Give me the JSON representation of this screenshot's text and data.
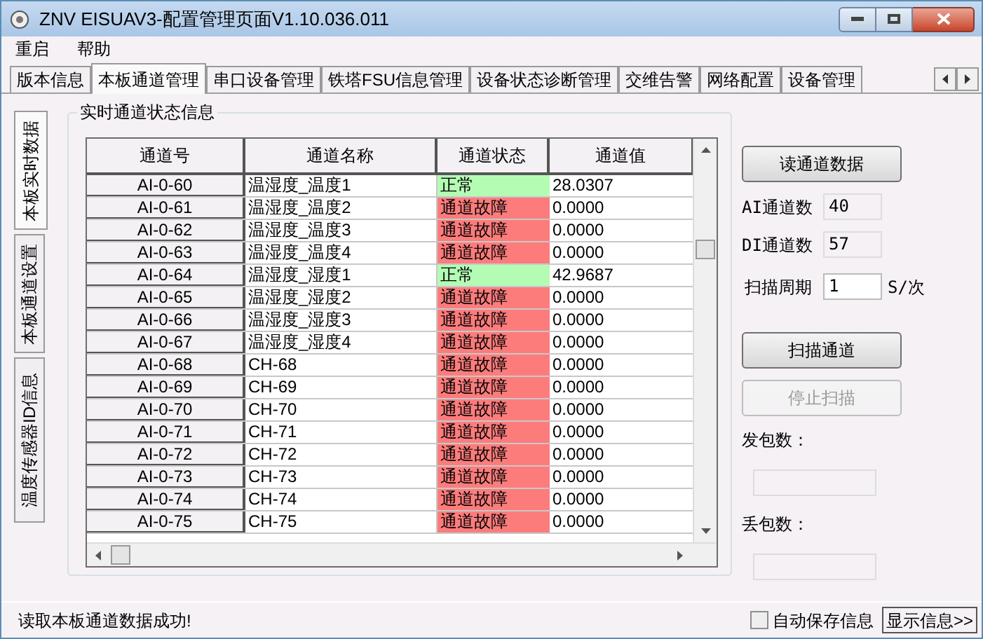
{
  "window": {
    "title": "ZNV EISUAV3-配置管理页面V1.10.036.011"
  },
  "menu": [
    "重启",
    "帮助"
  ],
  "tabs": [
    {
      "label": "版本信息",
      "selected": false
    },
    {
      "label": "本板通道管理",
      "selected": true
    },
    {
      "label": "串口设备管理",
      "selected": false
    },
    {
      "label": "铁塔FSU信息管理",
      "selected": false
    },
    {
      "label": "设备状态诊断管理",
      "selected": false
    },
    {
      "label": "交维告警",
      "selected": false
    },
    {
      "label": "网络配置",
      "selected": false
    },
    {
      "label": "设备管理",
      "selected": false
    }
  ],
  "side_tabs": [
    {
      "label": "本板实时数据",
      "selected": true
    },
    {
      "label": "本板通道设置",
      "selected": false
    },
    {
      "label": "温度传感器ID信息",
      "selected": false
    }
  ],
  "group_title": "实时通道状态信息",
  "table": {
    "columns": [
      "通道号",
      "通道名称",
      "通道状态",
      "通道值"
    ],
    "rows": [
      {
        "id": "AI-0-60",
        "name": "温湿度_温度1",
        "status": "正常",
        "kind": "normal",
        "value": "28.0307"
      },
      {
        "id": "AI-0-61",
        "name": "温湿度_温度2",
        "status": "通道故障",
        "kind": "fault",
        "value": "0.0000"
      },
      {
        "id": "AI-0-62",
        "name": "温湿度_温度3",
        "status": "通道故障",
        "kind": "fault",
        "value": "0.0000"
      },
      {
        "id": "AI-0-63",
        "name": "温湿度_温度4",
        "status": "通道故障",
        "kind": "fault",
        "value": "0.0000"
      },
      {
        "id": "AI-0-64",
        "name": "温湿度_湿度1",
        "status": "正常",
        "kind": "normal",
        "value": "42.9687"
      },
      {
        "id": "AI-0-65",
        "name": "温湿度_湿度2",
        "status": "通道故障",
        "kind": "fault",
        "value": "0.0000"
      },
      {
        "id": "AI-0-66",
        "name": "温湿度_湿度3",
        "status": "通道故障",
        "kind": "fault",
        "value": "0.0000"
      },
      {
        "id": "AI-0-67",
        "name": "温湿度_湿度4",
        "status": "通道故障",
        "kind": "fault",
        "value": "0.0000"
      },
      {
        "id": "AI-0-68",
        "name": "CH-68",
        "status": "通道故障",
        "kind": "fault",
        "value": "0.0000"
      },
      {
        "id": "AI-0-69",
        "name": "CH-69",
        "status": "通道故障",
        "kind": "fault",
        "value": "0.0000"
      },
      {
        "id": "AI-0-70",
        "name": "CH-70",
        "status": "通道故障",
        "kind": "fault",
        "value": "0.0000"
      },
      {
        "id": "AI-0-71",
        "name": "CH-71",
        "status": "通道故障",
        "kind": "fault",
        "value": "0.0000"
      },
      {
        "id": "AI-0-72",
        "name": "CH-72",
        "status": "通道故障",
        "kind": "fault",
        "value": "0.0000"
      },
      {
        "id": "AI-0-73",
        "name": "CH-73",
        "status": "通道故障",
        "kind": "fault",
        "value": "0.0000"
      },
      {
        "id": "AI-0-74",
        "name": "CH-74",
        "status": "通道故障",
        "kind": "fault",
        "value": "0.0000"
      },
      {
        "id": "AI-0-75",
        "name": "CH-75",
        "status": "通道故障",
        "kind": "fault",
        "value": "0.0000"
      }
    ]
  },
  "read_button": "读通道数据",
  "ai_count": {
    "label": "AI通道数",
    "value": "40"
  },
  "di_count": {
    "label": "DI通道数",
    "value": "57"
  },
  "scan_period": {
    "label": "扫描周期",
    "value": "1",
    "unit": "S/次"
  },
  "scan_button": {
    "label": "扫描通道",
    "disabled": false
  },
  "stop_button": {
    "label": "停止扫描",
    "disabled": true
  },
  "sent_label": "发包数：",
  "lost_label": "丢包数：",
  "status_bar": {
    "message": "读取本板通道数据成功!",
    "auto_save": {
      "label": "自动保存信息",
      "checked": false
    },
    "show_button": "显示信息>>"
  }
}
